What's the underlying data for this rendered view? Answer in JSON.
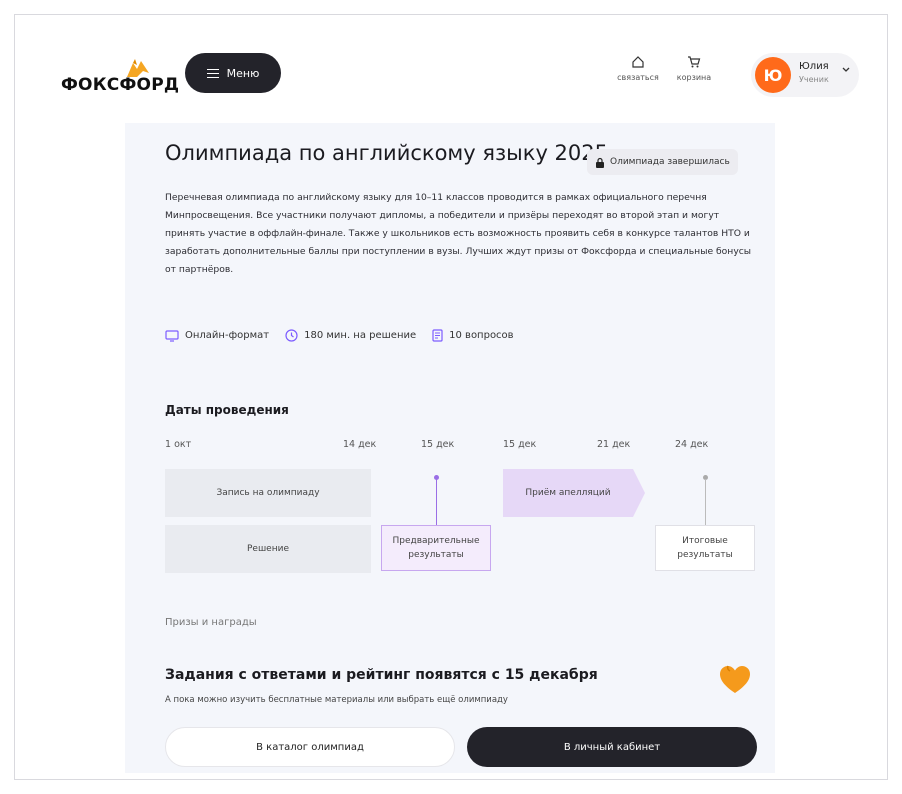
{
  "header": {
    "logo_text": "ФОКСФОРД",
    "menu_label": "Меню",
    "icons": [
      {
        "name": "home-icon",
        "label": "связаться"
      },
      {
        "name": "cart-icon",
        "label": "корзина"
      }
    ],
    "user": {
      "initial": "Ю",
      "name": "Юлия",
      "role": "Ученик"
    }
  },
  "olympiad": {
    "title": "Олимпиада по английскому языку 2025",
    "status": "Олимпиада завершилась",
    "description": "Перечневая олимпиада по английскому языку для 10–11 классов проводится в рамках официального перечня Минпросвещения. Все участники получают дипломы, а победители и призёры переходят во второй этап и могут принять участие в оффлайн-финале. Также у школьников есть возможность проявить себя в конкурсе талантов НТО и заработать дополнительные баллы при поступлении в вузы. Лучших ждут призы от Фоксфорда и специальные бонусы от партнёров.",
    "features": [
      {
        "icon": "monitor-icon",
        "label": "Онлайн-формат"
      },
      {
        "icon": "clock-icon",
        "label": "180 мин. на решение"
      },
      {
        "icon": "document-icon",
        "label": "10 вопросов"
      }
    ]
  },
  "timeline": {
    "title": "Даты проведения",
    "ticks": [
      "1 окт",
      "14 дек",
      "15 дек",
      "15 дек",
      "21 дек",
      "24 дек"
    ],
    "registration": "Запись на олимпиаду",
    "solving": "Решение",
    "appeals": "Приём апелляций",
    "preliminary": "Предварительные результаты",
    "final": "Итоговые результаты"
  },
  "prizes_label": "Призы и награды",
  "cta": {
    "title": "Задания с ответами и рейтинг появятся с 15 декабря",
    "subtitle": "А пока можно изучить бесплатные материалы или выбрать ещё олимпиаду",
    "catalog_button": "В каталог олимпиад",
    "cabinet_button": "В личный кабинет"
  },
  "colors": {
    "brand_orange": "#ff6a1a",
    "dark": "#23232a",
    "purple_light": "#e6d8f7",
    "purple_border": "#c7a7ef"
  }
}
